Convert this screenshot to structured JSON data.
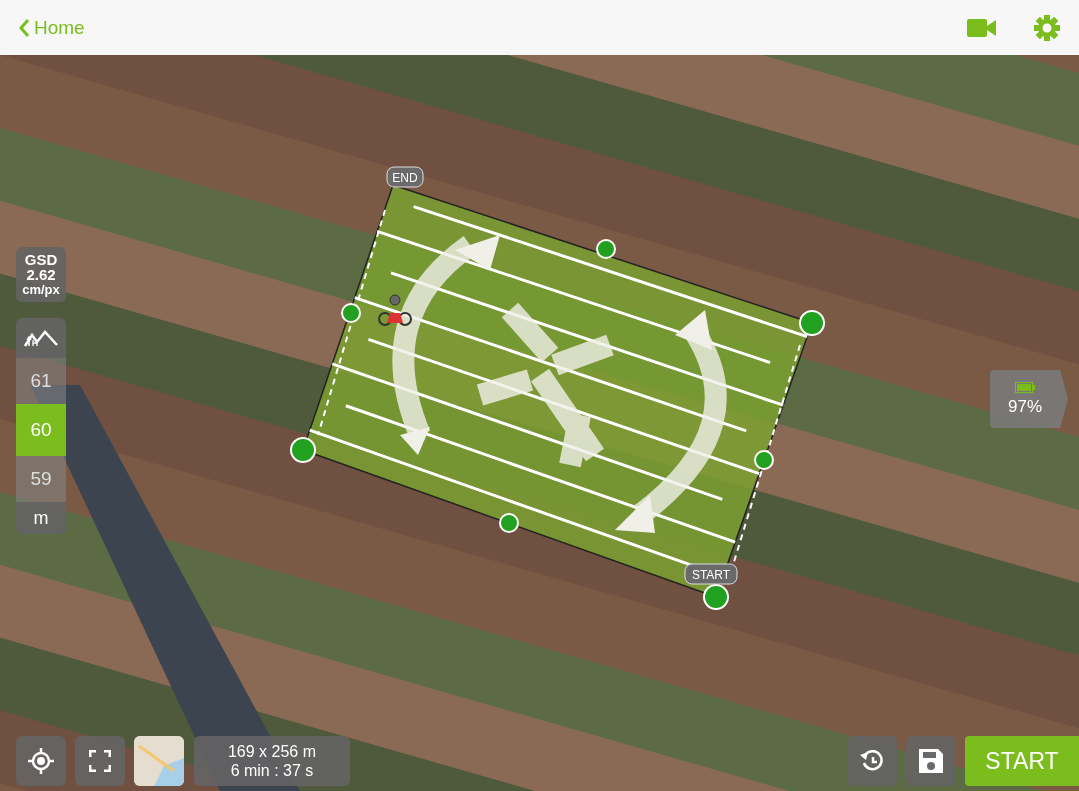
{
  "nav": {
    "back_label": "Home"
  },
  "survey_area": {
    "end_label": "END",
    "start_label": "START"
  },
  "gsd": {
    "label": "GSD",
    "value": "2.62",
    "unit": "cm/px"
  },
  "altitude": {
    "options": [
      {
        "value": "61",
        "selected": false
      },
      {
        "value": "60",
        "selected": true
      },
      {
        "value": "59",
        "selected": false
      }
    ],
    "unit": "m"
  },
  "battery": {
    "reading": "97%"
  },
  "mission_stats": {
    "size": "169 x 256 m",
    "duration": "6 min : 37 s"
  },
  "start_button": {
    "label": "START"
  }
}
